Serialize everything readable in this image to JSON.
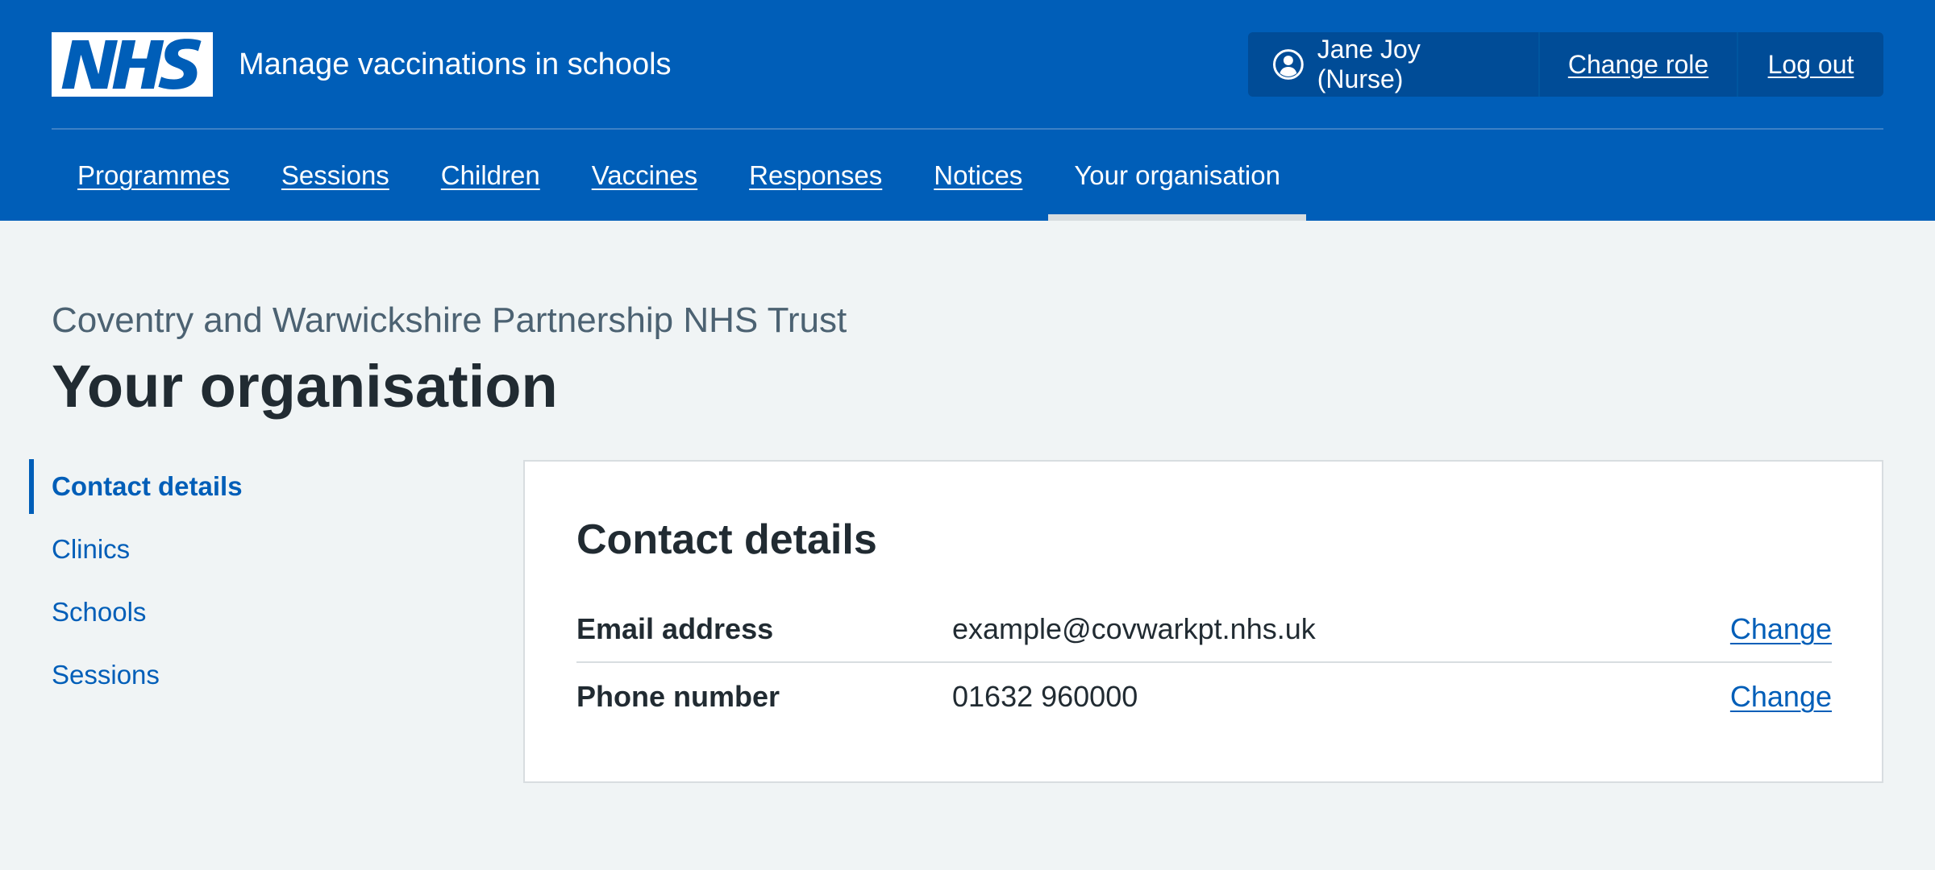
{
  "header": {
    "logo_text": "NHS",
    "service_name": "Manage vaccinations in schools",
    "account": {
      "user_label": "Jane Joy (Nurse)",
      "change_role": "Change role",
      "log_out": "Log out"
    },
    "nav": [
      {
        "label": "Programmes",
        "active": false
      },
      {
        "label": "Sessions",
        "active": false
      },
      {
        "label": "Children",
        "active": false
      },
      {
        "label": "Vaccines",
        "active": false
      },
      {
        "label": "Responses",
        "active": false
      },
      {
        "label": "Notices",
        "active": false
      },
      {
        "label": "Your organisation",
        "active": true
      }
    ]
  },
  "page": {
    "caption": "Coventry and Warwickshire Partnership NHS Trust",
    "title": "Your organisation"
  },
  "sidenav": [
    {
      "label": "Contact details",
      "active": true
    },
    {
      "label": "Clinics",
      "active": false
    },
    {
      "label": "Schools",
      "active": false
    },
    {
      "label": "Sessions",
      "active": false
    }
  ],
  "card": {
    "title": "Contact details",
    "rows": [
      {
        "key": "Email address",
        "value": "example@covwarkpt.nhs.uk",
        "action": "Change"
      },
      {
        "key": "Phone number",
        "value": "01632 960000",
        "action": "Change"
      }
    ]
  },
  "colors": {
    "brand_blue": "#005eb8",
    "account_bg": "#004c97",
    "page_bg": "#f0f4f5",
    "text": "#212b32",
    "secondary_text": "#4c6272",
    "border": "#d8dde0"
  }
}
